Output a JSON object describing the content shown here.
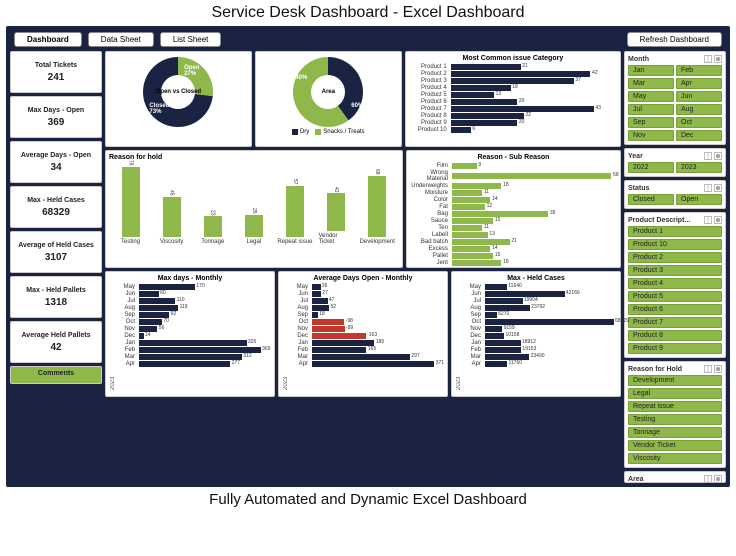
{
  "title_top": "Service Desk Dashboard - Excel Dashboard",
  "title_bottom": "Fully Automated and Dynamic Excel Dashboard",
  "buttons": {
    "dashboard": "Dashboard",
    "data_sheet": "Data Sheet",
    "list_sheet": "List Sheet",
    "refresh": "Refresh Dashboard"
  },
  "kpis": [
    {
      "label": "Total Tickets",
      "value": "241"
    },
    {
      "label": "Max Days - Open",
      "value": "369"
    },
    {
      "label": "Average Days - Open",
      "value": "34"
    },
    {
      "label": "Max - Held Cases",
      "value": "68329"
    },
    {
      "label": "Average of Held Cases",
      "value": "3107"
    },
    {
      "label": "Max - Held Pallets",
      "value": "1318"
    },
    {
      "label": "Average Held Pallets",
      "value": "42"
    }
  ],
  "comments_label": "Comments",
  "donut1": {
    "center": "Open\nvs\nClosed",
    "open_label": "Open",
    "open_pct": "27%",
    "closed_label": "Closed",
    "closed_pct": "73%"
  },
  "donut2": {
    "center": "Area",
    "a_pct": "40%",
    "b_pct": "60%",
    "legend_a": "Dry",
    "legend_b": "Snacks / Treats"
  },
  "chart_titles": {
    "issue": "Most Common issue Category",
    "reason_hold": "Reason for hold",
    "sub_reason": "Reason - Sub Reason",
    "max_monthly": "Max days - Monthly",
    "avg_monthly": "Average Days Open - Monthly",
    "max_held": "Max - Held Cases"
  },
  "slicers": {
    "month": {
      "title": "Month",
      "items": [
        "Jan",
        "Feb",
        "Mar",
        "Apr",
        "May",
        "Jun",
        "Jul",
        "Aug",
        "Sep",
        "Oct",
        "Nov",
        "Dec"
      ]
    },
    "year": {
      "title": "Year",
      "items": [
        "2022",
        "2023"
      ]
    },
    "status": {
      "title": "Status",
      "items": [
        "Closed",
        "Open"
      ]
    },
    "product": {
      "title": "Product Descript...",
      "items": [
        "Product 1",
        "Product 10",
        "Product 2",
        "Product 3",
        "Product 4",
        "Product 5",
        "Product 6",
        "Product 7",
        "Product 8",
        "Product 9"
      ]
    },
    "reason": {
      "title": "Reason for Hold",
      "items": [
        "Development",
        "Legal",
        "Repeat issue",
        "Testing",
        "Tonnage",
        "Vendor Ticket",
        "Viscosity"
      ]
    },
    "area": {
      "title": "Area"
    }
  },
  "year_2023": "2023",
  "year_2022": "2022",
  "chart_data": [
    {
      "type": "pie",
      "title": "Open vs Closed",
      "series": [
        {
          "name": "Open",
          "value": 27
        },
        {
          "name": "Closed",
          "value": 73
        }
      ]
    },
    {
      "type": "pie",
      "title": "Area",
      "series": [
        {
          "name": "Dry",
          "value": 40
        },
        {
          "name": "Snacks / Treats",
          "value": 60
        }
      ]
    },
    {
      "type": "bar",
      "title": "Most Common issue Category",
      "orientation": "horizontal",
      "categories": [
        "Product 1",
        "Product 2",
        "Product 3",
        "Product 4",
        "Product 5",
        "Product 6",
        "Product 7",
        "Product 8",
        "Product 9",
        "Product 10"
      ],
      "values": [
        21,
        42,
        37,
        18,
        13,
        20,
        43,
        22,
        20,
        6
      ]
    },
    {
      "type": "bar",
      "title": "Reason for hold",
      "orientation": "vertical",
      "categories": [
        "Testing",
        "Viscosity",
        "Tonnage",
        "Legal",
        "Repeat issue",
        "Vendor Ticket",
        "Development"
      ],
      "values": [
        78,
        45,
        23,
        25,
        57,
        42,
        68
      ]
    },
    {
      "type": "bar",
      "title": "Reason - Sub Reason",
      "orientation": "horizontal",
      "categories": [
        "Film",
        "Wrong Material",
        "Underweights",
        "Moisture",
        "Color",
        "Fat",
        "Bag",
        "Sauce",
        "Ten",
        "Labell",
        "Bad batch",
        "Excess",
        "Pallet",
        "Jent"
      ],
      "values": [
        9,
        58,
        18,
        11,
        14,
        12,
        35,
        15,
        11,
        13,
        21,
        14,
        15,
        18
      ]
    },
    {
      "type": "bar",
      "title": "Max days - Monthly",
      "orientation": "horizontal",
      "series": [
        {
          "name": "2023",
          "categories": [
            "May",
            "Jun",
            "Jul",
            "Aug",
            "Sep",
            "Oct",
            "Nov",
            "Dec"
          ],
          "values": [
            170,
            60,
            110,
            119,
            92,
            70,
            56,
            14
          ]
        },
        {
          "name": "2022",
          "categories": [
            "Jan",
            "Feb",
            "Mar",
            "Apr"
          ],
          "values": [
            326,
            369,
            312,
            277
          ]
        }
      ]
    },
    {
      "type": "bar",
      "title": "Average Days Open - Monthly",
      "orientation": "horizontal",
      "series": [
        {
          "name": "2023",
          "categories": [
            "May",
            "Jun",
            "Jul",
            "Aug",
            "Sep",
            "Oct",
            "Nov",
            "Dec"
          ],
          "values": [
            26,
            27,
            47,
            52,
            18,
            -98,
            -99,
            -163
          ]
        },
        {
          "name": "2022",
          "categories": [
            "Jan",
            "Feb",
            "Mar",
            "Apr"
          ],
          "values": [
            189,
            165,
            297,
            371
          ]
        }
      ]
    },
    {
      "type": "bar",
      "title": "Max - Held Cases",
      "orientation": "horizontal",
      "series": [
        {
          "name": "2023",
          "categories": [
            "May",
            "Jun",
            "Jul",
            "Aug",
            "Sep",
            "Oct",
            "Nov",
            "Dec"
          ],
          "values": [
            11640,
            42166,
            19904,
            23792,
            6270,
            68329,
            9159,
            10158
          ]
        },
        {
          "name": "2022",
          "categories": [
            "Jan",
            "Feb",
            "Mar",
            "Apr"
          ],
          "values": [
            18912,
            19153,
            23490,
            11760
          ]
        }
      ]
    }
  ]
}
